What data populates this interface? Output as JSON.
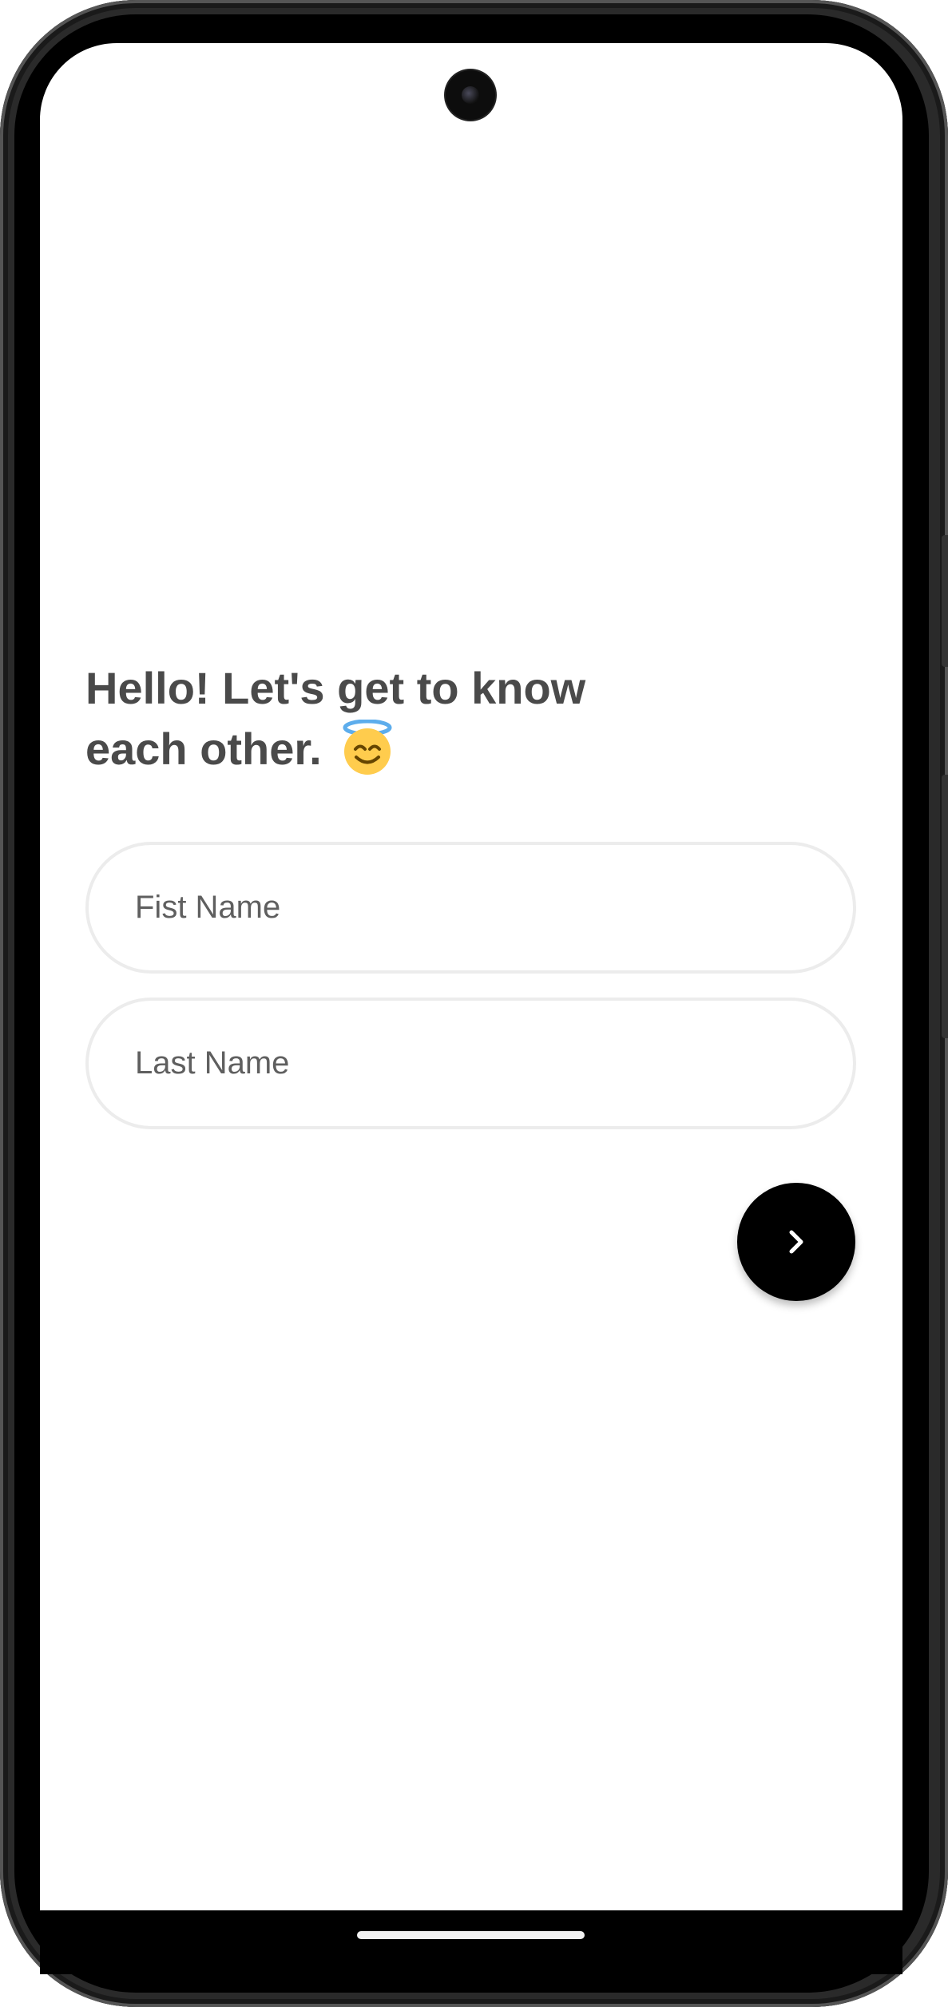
{
  "onboarding": {
    "heading_line1": "Hello! Let's get to know",
    "heading_line2": "each other.",
    "heading_emoji": "smiling-face-with-halo-icon"
  },
  "form": {
    "first_name_placeholder": "Fist Name",
    "first_name_value": "",
    "last_name_placeholder": "Last Name",
    "last_name_value": ""
  },
  "next_button": {
    "icon": "chevron-right-icon"
  },
  "colors": {
    "heading": "#4a4a4a",
    "field_border": "#ececec",
    "button_bg": "#000000",
    "background": "#ffffff"
  }
}
